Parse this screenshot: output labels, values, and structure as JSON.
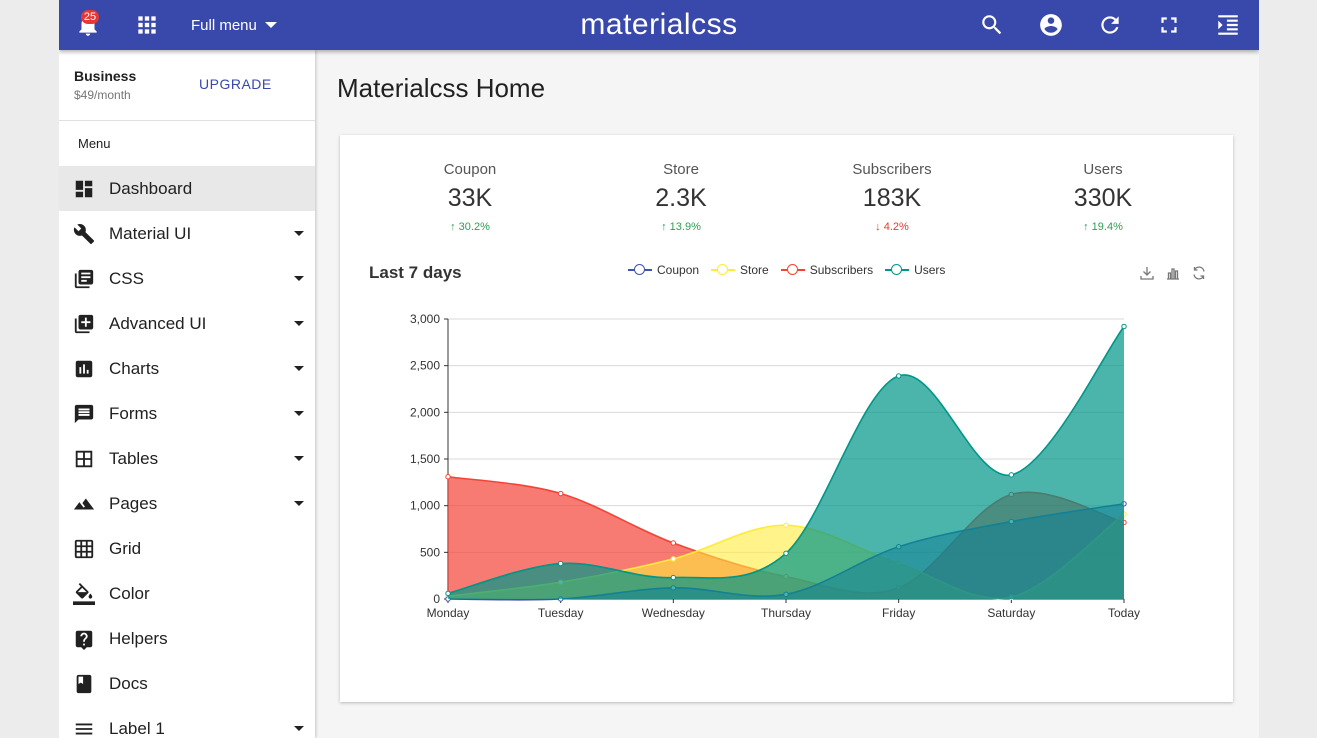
{
  "topbar": {
    "notification_count": "25",
    "full_menu_label": "Full menu",
    "brand": "materialcss"
  },
  "sidebar": {
    "plan_name": "Business",
    "plan_price": "$49/month",
    "upgrade_label": "UPGRADE",
    "menu_header": "Menu",
    "items": [
      {
        "label": "Dashboard",
        "icon": "dashboard-icon",
        "caret": false,
        "active": true
      },
      {
        "label": "Material UI",
        "icon": "wrench-icon",
        "caret": true
      },
      {
        "label": "CSS",
        "icon": "library-books-icon",
        "caret": true
      },
      {
        "label": "Advanced UI",
        "icon": "library-add-icon",
        "caret": true
      },
      {
        "label": "Charts",
        "icon": "bar-chart-icon",
        "caret": true
      },
      {
        "label": "Forms",
        "icon": "message-icon",
        "caret": true
      },
      {
        "label": "Tables",
        "icon": "table-icon",
        "caret": true
      },
      {
        "label": "Pages",
        "icon": "terrain-icon",
        "caret": true
      },
      {
        "label": "Grid",
        "icon": "grid-icon",
        "caret": false
      },
      {
        "label": "Color",
        "icon": "color-fill-icon",
        "caret": false
      },
      {
        "label": "Helpers",
        "icon": "help-box-icon",
        "caret": false
      },
      {
        "label": "Docs",
        "icon": "book-icon",
        "caret": false
      },
      {
        "label": "Label 1",
        "icon": "menu-lines-icon",
        "caret": true
      }
    ]
  },
  "main": {
    "page_title": "Materialcss Home",
    "stats": [
      {
        "label": "Coupon",
        "value": "33K",
        "change": "30.2%",
        "direction": "up"
      },
      {
        "label": "Store",
        "value": "2.3K",
        "change": "13.9%",
        "direction": "up"
      },
      {
        "label": "Subscribers",
        "value": "183K",
        "change": "4.2%",
        "direction": "down"
      },
      {
        "label": "Users",
        "value": "330K",
        "change": "19.4%",
        "direction": "up"
      }
    ],
    "chart_title": "Last 7 days"
  },
  "colors": {
    "primary": "#3949ab",
    "up": "#2e9d55",
    "down": "#e53935"
  },
  "chart_data": {
    "type": "area",
    "title": "Last 7 days",
    "categories": [
      "Monday",
      "Tuesday",
      "Wednesday",
      "Thursday",
      "Friday",
      "Saturday",
      "Today"
    ],
    "ylim": [
      0,
      3000
    ],
    "yticks": [
      "0",
      "500",
      "1,000",
      "1,500",
      "2,000",
      "2,500",
      "3,000"
    ],
    "legend_position": "top-center",
    "grid": true,
    "series": [
      {
        "name": "Coupon",
        "color": "#3f51b5",
        "fill": "rgba(63,81,181,0.55)",
        "values": [
          0,
          0,
          120,
          50,
          560,
          830,
          1020
        ]
      },
      {
        "name": "Store",
        "color": "#ffeb3b",
        "fill": "rgba(255,235,59,0.6)",
        "values": [
          30,
          180,
          430,
          790,
          380,
          20,
          910
        ]
      },
      {
        "name": "Subscribers",
        "color": "#f44336",
        "fill": "rgba(244,67,54,0.7)",
        "values": [
          1310,
          1130,
          600,
          240,
          120,
          1120,
          820
        ]
      },
      {
        "name": "Users",
        "color": "#009688",
        "fill": "rgba(0,150,136,0.7)",
        "values": [
          60,
          380,
          230,
          490,
          2390,
          1330,
          2920
        ]
      }
    ]
  }
}
